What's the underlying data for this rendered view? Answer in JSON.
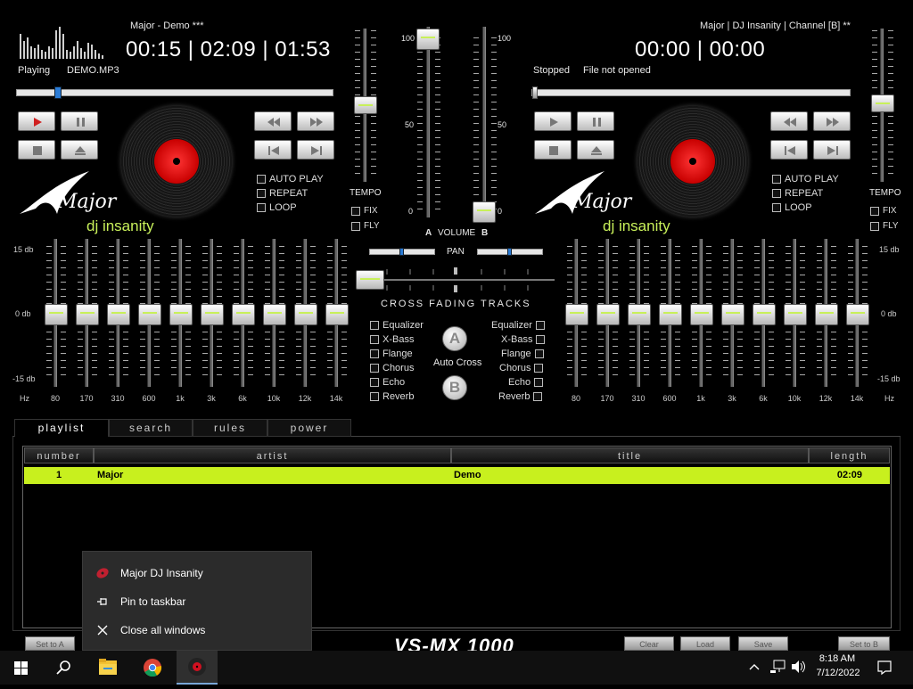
{
  "deckA": {
    "title": "Major - Demo ***",
    "time": "00:15 | 02:09 | 01:53",
    "status": "Playing",
    "file": "DEMO.MP3",
    "progress": 0.12,
    "options": [
      "AUTO PLAY",
      "REPEAT",
      "LOOP"
    ],
    "tempo_label": "TEMPO",
    "fix_label": "FIX",
    "fly_label": "FLY",
    "logo": "Major",
    "logo_sub": "dj insanity"
  },
  "deckB": {
    "title": "Major | DJ Insanity | Channel [B] **",
    "time": "00:00 | 00:00",
    "status": "Stopped",
    "file": "File not opened",
    "progress": 0.0,
    "options": [
      "AUTO PLAY",
      "REPEAT",
      "LOOP"
    ],
    "tempo_label": "TEMPO",
    "fix_label": "FIX",
    "fly_label": "FLY",
    "logo": "Major",
    "logo_sub": "dj insanity"
  },
  "mixer": {
    "scale_top": "100",
    "scale_mid": "50",
    "scale_bottom": "0",
    "label_a": "A",
    "label_b": "B",
    "volume_label": "VOLUME",
    "pan_label": "PAN",
    "crossfade_label": "CROSS FADING TRACKS",
    "auto_cross_label": "Auto Cross",
    "effects": [
      "Equalizer",
      "X-Bass",
      "Flange",
      "Chorus",
      "Echo",
      "Reverb"
    ]
  },
  "eq": {
    "db_top": "15 db",
    "db_mid": "0 db",
    "db_bottom": "-15 db",
    "hz_label": "Hz",
    "bands": [
      "80",
      "170",
      "310",
      "600",
      "1k",
      "3k",
      "6k",
      "10k",
      "12k",
      "14k"
    ]
  },
  "tabs": [
    "playlist",
    "search",
    "rules",
    "power"
  ],
  "playlist": {
    "columns": [
      "number",
      "artist",
      "title",
      "length"
    ],
    "rows": [
      {
        "number": "1",
        "artist": "Major",
        "title": "Demo",
        "length": "02:09"
      }
    ]
  },
  "bottom": {
    "set_a": "Set to A",
    "clear": "Clear",
    "load": "Load",
    "save": "Save",
    "set_b": "Set to B",
    "brand": "VS-MX 1000"
  },
  "context_menu": {
    "items": [
      "Major DJ Insanity",
      "Pin to taskbar",
      "Close all windows"
    ]
  },
  "taskbar": {
    "time": "8:18 AM",
    "date": "7/12/2022"
  },
  "colors": {
    "accent": "#c8f05a",
    "record_label": "#d00000",
    "playlist_highlight": "#c8f01e"
  }
}
